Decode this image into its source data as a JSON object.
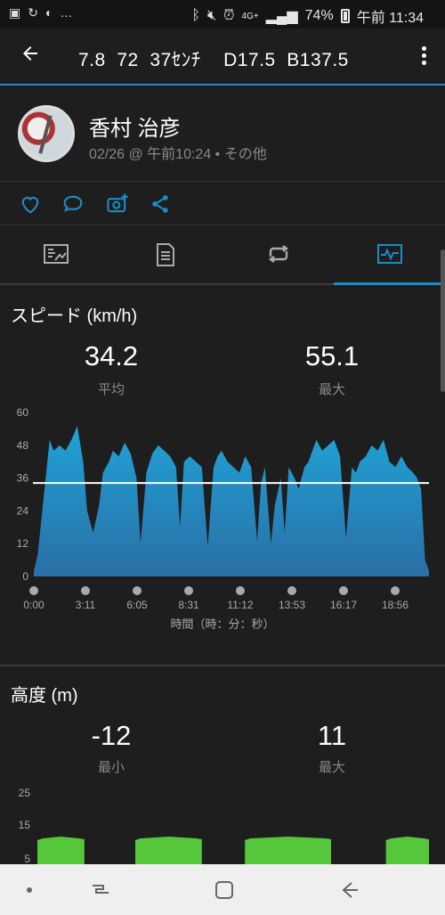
{
  "status": {
    "left_icons": [
      "gallery-icon",
      "sync-icon",
      "messenger-icon",
      "more-dots-icon"
    ],
    "right_icons": [
      "bluetooth-icon",
      "mute-icon",
      "alarm-icon",
      "volte-icon",
      "signal-icon"
    ],
    "network": "4G+",
    "battery": "74%",
    "time": "午前 11:34"
  },
  "appbar": {
    "title": "7.8  72  37ｾﾝﾁ    D17.5  B137.5"
  },
  "profile": {
    "name": "香村 治彦",
    "meta": "02/26 @ 午前10:24 • その他"
  },
  "actions": [
    "like-icon",
    "comment-icon",
    "add-photo-icon",
    "share-icon"
  ],
  "tabs": [
    "summary-tab",
    "details-tab",
    "laps-tab",
    "charts-tab"
  ],
  "speed": {
    "title": "スピード (km/h)",
    "avg_value": "34.2",
    "avg_label": "平均",
    "max_value": "55.1",
    "max_label": "最大",
    "x_title": "時間（時：分：秒）"
  },
  "elevation": {
    "title": "高度 (m)",
    "min_value": "-12",
    "min_label": "最小",
    "max_value": "11",
    "max_label": "最大"
  },
  "colors": {
    "accent": "#1b8cc8",
    "speed_fill_top": "#1fa3d6",
    "speed_fill_bottom": "#2a6fa6",
    "elev_fill": "#56c63a"
  },
  "chart_data": [
    {
      "type": "area",
      "yticks": [
        0,
        12,
        24,
        36,
        48,
        60
      ],
      "ylim": [
        0,
        60
      ],
      "xticks": [
        "0:00",
        "3:11",
        "6:05",
        "8:31",
        "11:12",
        "13:53",
        "16:17",
        "18:56"
      ],
      "avg_line": 34.2,
      "series": [
        {
          "x_frac": [
            0,
            0.01,
            0.03,
            0.04,
            0.05,
            0.065,
            0.08,
            0.095,
            0.11,
            0.125,
            0.135,
            0.15,
            0.165,
            0.175,
            0.19,
            0.2,
            0.215,
            0.23,
            0.245,
            0.26,
            0.27,
            0.285,
            0.3,
            0.315,
            0.33,
            0.345,
            0.36,
            0.37,
            0.38,
            0.395,
            0.41,
            0.425,
            0.44,
            0.455,
            0.465,
            0.475,
            0.49,
            0.505,
            0.52,
            0.535,
            0.55,
            0.565,
            0.575,
            0.585,
            0.6,
            0.61,
            0.625,
            0.635,
            0.645,
            0.66,
            0.67,
            0.685,
            0.695,
            0.705,
            0.715,
            0.73,
            0.745,
            0.76,
            0.775,
            0.79,
            0.805,
            0.815,
            0.825,
            0.84,
            0.855,
            0.87,
            0.885,
            0.9,
            0.915,
            0.93,
            0.945,
            0.96,
            0.97,
            0.98,
            0.99,
            1
          ],
          "values": [
            2,
            8,
            36,
            50,
            46,
            48,
            46,
            50,
            55,
            42,
            24,
            16,
            26,
            38,
            42,
            46,
            44,
            49,
            45,
            36,
            12,
            38,
            45,
            48,
            46,
            44,
            40,
            18,
            42,
            44,
            42,
            40,
            11,
            40,
            44,
            46,
            42,
            40,
            38,
            44,
            40,
            13,
            34,
            40,
            12,
            26,
            36,
            16,
            40,
            36,
            32,
            40,
            42,
            46,
            50,
            46,
            48,
            50,
            44,
            14,
            40,
            38,
            42,
            44,
            48,
            46,
            50,
            42,
            40,
            44,
            40,
            38,
            36,
            32,
            6,
            2
          ]
        }
      ]
    },
    {
      "type": "area",
      "yticks": [
        5,
        15,
        25
      ],
      "series": [
        {
          "segments": [
            {
              "x_frac": [
                0.0,
                0.12
              ],
              "level": 8
            },
            {
              "x_frac": [
                0.25,
                0.42
              ],
              "level": 8
            },
            {
              "x_frac": [
                0.53,
                0.75
              ],
              "level": 8
            },
            {
              "x_frac": [
                0.89,
                1.0
              ],
              "level": 8
            }
          ]
        }
      ]
    }
  ]
}
